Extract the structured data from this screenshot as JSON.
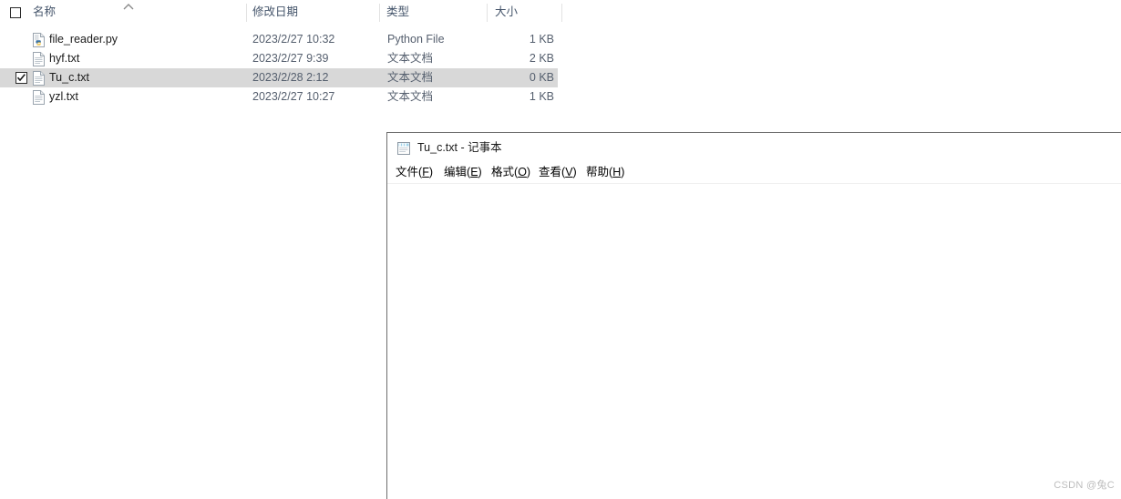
{
  "explorer": {
    "columns": [
      {
        "key": "name",
        "label": "名称",
        "sorted": "ascending"
      },
      {
        "key": "date",
        "label": "修改日期"
      },
      {
        "key": "type",
        "label": "类型"
      },
      {
        "key": "size",
        "label": "大小"
      }
    ],
    "select_all_checked": false,
    "rows": [
      {
        "name": "file_reader.py",
        "date": "2023/2/27 10:32",
        "type": "Python File",
        "size": "1 KB",
        "icon": "python-file-icon",
        "selected": false,
        "checked": false
      },
      {
        "name": "hyf.txt",
        "date": "2023/2/27 9:39",
        "type": "文本文档",
        "size": "2 KB",
        "icon": "text-file-icon",
        "selected": false,
        "checked": false
      },
      {
        "name": "Tu_c.txt",
        "date": "2023/2/28 2:12",
        "type": "文本文档",
        "size": "0 KB",
        "icon": "text-file-icon",
        "selected": true,
        "checked": true
      },
      {
        "name": "yzl.txt",
        "date": "2023/2/27 10:27",
        "type": "文本文档",
        "size": "1 KB",
        "icon": "text-file-icon",
        "selected": false,
        "checked": false
      }
    ]
  },
  "notepad": {
    "title": "Tu_c.txt - 记事本",
    "icon": "notepad-icon",
    "menu": [
      {
        "label": "文件",
        "accelerator": "F"
      },
      {
        "label": "编辑",
        "accelerator": "E"
      },
      {
        "label": "格式",
        "accelerator": "O"
      },
      {
        "label": "查看",
        "accelerator": "V"
      },
      {
        "label": "帮助",
        "accelerator": "H"
      }
    ],
    "content": "",
    "content_placeholder": ""
  },
  "watermark": {
    "text": "CSDN @兔C"
  },
  "colors": {
    "header_text": "#44546a",
    "row_text": "#1a1a1a",
    "secondary_text": "#555f6e",
    "selected_row_bg": "#d8d8d8",
    "separator": "#e2e2e2",
    "window_border": "#6e6e6e",
    "watermark": "#bdbdbd"
  }
}
